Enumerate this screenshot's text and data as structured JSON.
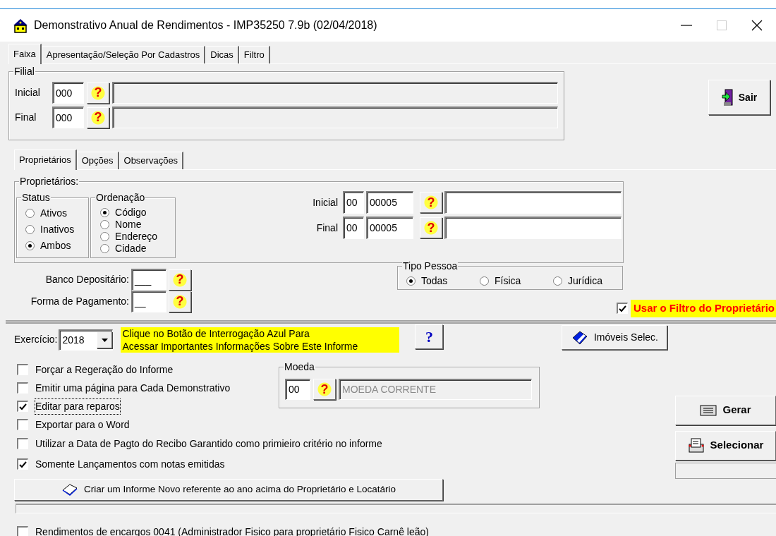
{
  "window": {
    "title": "Demonstrativo Anual de Rendimentos - IMP35250 7.9b (02/04/2018)"
  },
  "main_tabs": [
    {
      "label": "Faixa",
      "selected": true
    },
    {
      "label": "Apresentação/Seleção Por Cadastros",
      "selected": false
    },
    {
      "label": "Dicas",
      "selected": false
    },
    {
      "label": "Filtro",
      "selected": false
    }
  ],
  "filial": {
    "title": "Filial",
    "rows": [
      {
        "label": "Inicial",
        "code": "000",
        "lookup": "?"
      },
      {
        "label": "Final",
        "code": "000",
        "lookup": "?"
      }
    ]
  },
  "exit_button": {
    "label": "Sair"
  },
  "sub_tabs": [
    {
      "label": "Proprietários",
      "selected": true
    },
    {
      "label": "Opções",
      "selected": false
    },
    {
      "label": "Observações",
      "selected": false
    }
  ],
  "proprietarios": {
    "title": "Proprietários:",
    "status": {
      "title": "Status",
      "options": [
        {
          "label": "Ativos",
          "selected": false
        },
        {
          "label": "Inativos",
          "selected": false
        },
        {
          "label": "Ambos",
          "selected": true
        }
      ]
    },
    "ordenacao": {
      "title": "Ordenação",
      "options": [
        {
          "label": "Código",
          "selected": true
        },
        {
          "label": "Nome",
          "selected": false
        },
        {
          "label": "Endereço",
          "selected": false
        },
        {
          "label": "Cidade",
          "selected": false
        }
      ]
    },
    "range": [
      {
        "label": "Inicial",
        "prefix": "00",
        "code": "00005",
        "lookup": "?"
      },
      {
        "label": "Final",
        "prefix": "00",
        "code": "00005",
        "lookup": "?"
      }
    ]
  },
  "banco": {
    "label": "Banco Depositário:",
    "value": "___",
    "lookup": "?"
  },
  "forma_pagamento": {
    "label": "Forma de Pagamento:",
    "value": "__",
    "lookup": "?"
  },
  "tipo_pessoa": {
    "title": "Tipo Pessoa",
    "options": [
      {
        "label": "Todas",
        "selected": true
      },
      {
        "label": "Física",
        "selected": false
      },
      {
        "label": "Jurídica",
        "selected": false
      }
    ]
  },
  "owner_filter": {
    "label": "Usar o Filtro do Proprietário",
    "checked": true
  },
  "exercicio": {
    "label": "Exercício:",
    "value": "2018"
  },
  "note": {
    "lines": [
      "Clique no Botão de Interrogação Azul Para",
      "Acessar Importantes Informações Sobre Este Informe"
    ]
  },
  "info_button": {
    "label": "?"
  },
  "imoveis_button": {
    "label": "Imóveis Selec."
  },
  "options": [
    {
      "label": "Forçar a Regeração do Informe",
      "checked": false,
      "focused": false
    },
    {
      "label": "Emitir uma página para Cada Demonstrativo",
      "checked": false,
      "focused": false
    },
    {
      "label": "Editar para reparos",
      "checked": true,
      "focused": true
    },
    {
      "label": "Exportar para o Word",
      "checked": false,
      "focused": false
    },
    {
      "label": "Utilizar a Data de Pagto do Recibo Garantido como primieiro critério no informe",
      "checked": false,
      "focused": false
    },
    {
      "label": "Somente Lançamentos com notas emitidas",
      "checked": true,
      "focused": false
    }
  ],
  "moeda": {
    "title": "Moeda",
    "code": "00",
    "lookup": "?",
    "name": "MOEDA CORRENTE"
  },
  "action_buttons": [
    {
      "label": "Gerar",
      "kind": "generate"
    },
    {
      "label": "Selecionar",
      "kind": "select"
    }
  ],
  "create_button": {
    "label": "Criar um Informe Novo referente ao ano acima do Proprietário e Locatário"
  },
  "progress": {
    "level": 0
  },
  "encargos": {
    "label": "Rendimentos de encargos 0041 (Administrador Fisico para proprietário Fisico Carnê leão)",
    "checked": false
  }
}
